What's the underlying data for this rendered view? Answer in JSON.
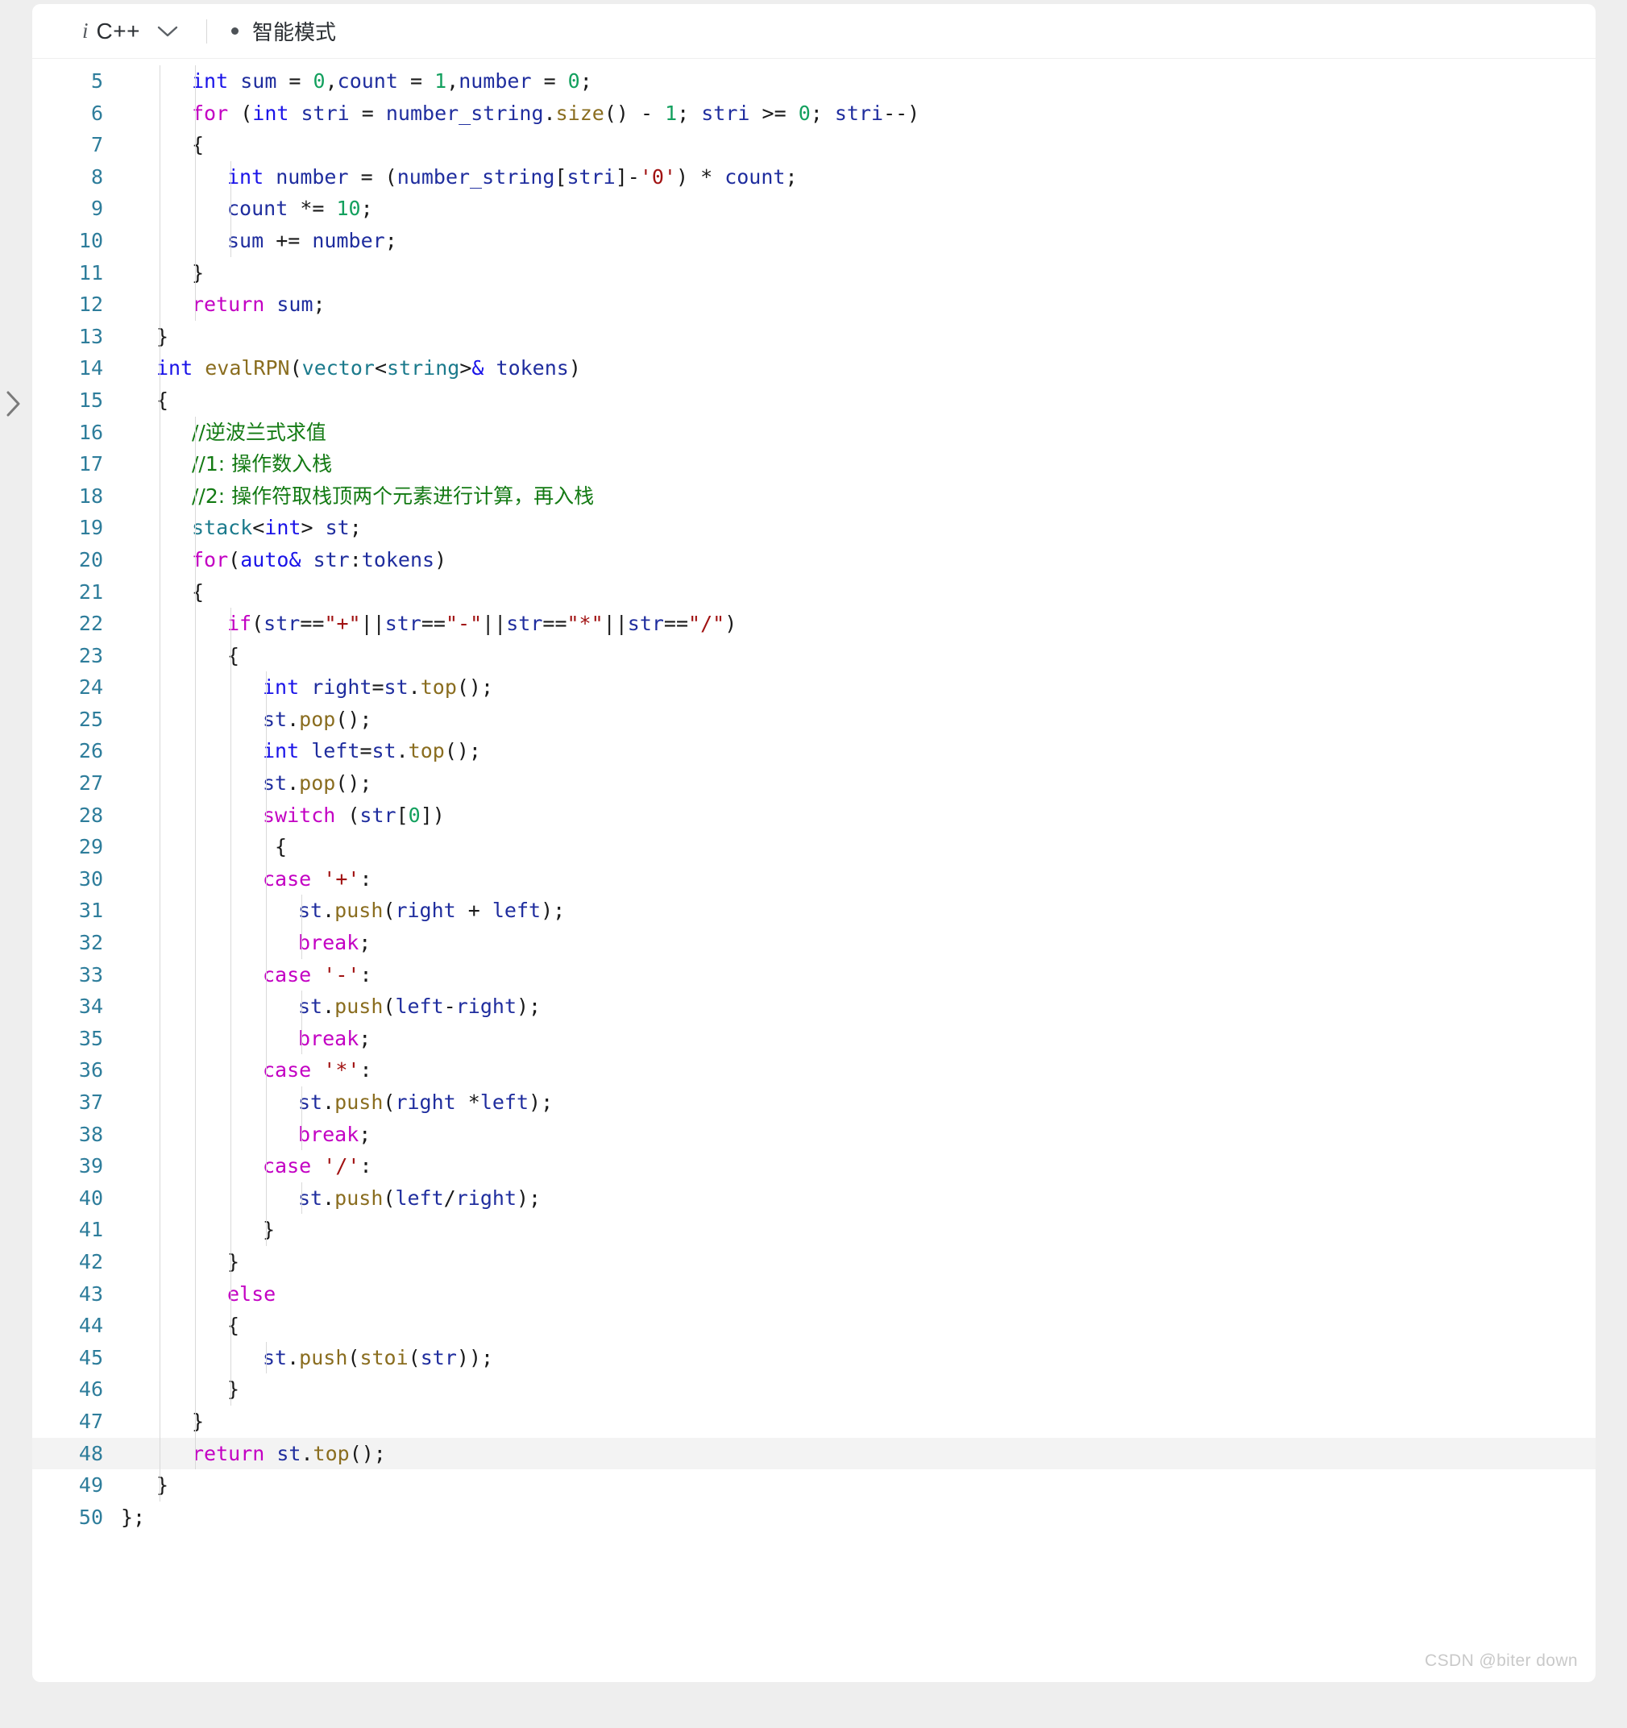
{
  "toolbar": {
    "info_icon": "i",
    "language": "C++",
    "chevron_icon": "chevron-down-icon",
    "status_dot": "status-dot",
    "mode_label": "智能模式"
  },
  "left_rail": {
    "collapse_icon": "chevron-right-icon"
  },
  "watermark": "CSDN @biter down",
  "editor": {
    "first_visible_line": 5,
    "last_visible_line": 50,
    "highlighted_line": 48,
    "colors": {
      "background": "#ffffff",
      "page_background": "#eeeeee",
      "line_number": "#2e7d9b",
      "keyword": "#c300c3",
      "type": "#1a13e8",
      "number": "#13a05e",
      "string": "#a11212",
      "function": "#8a6d1f",
      "class_name": "#1b7a8c",
      "identifier": "#1f2d9e",
      "comment": "#137a13",
      "plain": "#1a1a1a",
      "highlight_band": "#f3f3f3",
      "indent_guide": "#d9d9d9"
    },
    "lines": [
      {
        "num": 5,
        "indent": 2,
        "guides": 2,
        "text": "int sum = 0,count = 1,number = 0;"
      },
      {
        "num": 6,
        "indent": 2,
        "guides": 2,
        "text": "for (int stri = number_string.size() - 1; stri >= 0; stri--)"
      },
      {
        "num": 7,
        "indent": 2,
        "guides": 2,
        "text": "{"
      },
      {
        "num": 8,
        "indent": 3,
        "guides": 3,
        "text": "int number = (number_string[stri]-'0') * count;"
      },
      {
        "num": 9,
        "indent": 3,
        "guides": 3,
        "text": "count *= 10;"
      },
      {
        "num": 10,
        "indent": 3,
        "guides": 3,
        "text": "sum += number;"
      },
      {
        "num": 11,
        "indent": 2,
        "guides": 2,
        "text": "}"
      },
      {
        "num": 12,
        "indent": 2,
        "guides": 2,
        "text": "return sum;"
      },
      {
        "num": 13,
        "indent": 1,
        "guides": 1,
        "text": "}"
      },
      {
        "num": 14,
        "indent": 1,
        "guides": 1,
        "text": "int evalRPN(vector<string>& tokens)"
      },
      {
        "num": 15,
        "indent": 1,
        "guides": 1,
        "text": "{"
      },
      {
        "num": 16,
        "indent": 2,
        "guides": 2,
        "text": "//逆波兰式求值"
      },
      {
        "num": 17,
        "indent": 2,
        "guides": 2,
        "text": "//1: 操作数入栈"
      },
      {
        "num": 18,
        "indent": 2,
        "guides": 2,
        "text": "//2: 操作符取栈顶两个元素进行计算，再入栈"
      },
      {
        "num": 19,
        "indent": 2,
        "guides": 2,
        "text": "stack<int> st;"
      },
      {
        "num": 20,
        "indent": 2,
        "guides": 2,
        "text": "for(auto& str:tokens)"
      },
      {
        "num": 21,
        "indent": 2,
        "guides": 2,
        "text": "{"
      },
      {
        "num": 22,
        "indent": 3,
        "guides": 3,
        "text": "if(str==\"+\"||str==\"-\"||str==\"*\"||str==\"/\")"
      },
      {
        "num": 23,
        "indent": 3,
        "guides": 3,
        "text": "{"
      },
      {
        "num": 24,
        "indent": 4,
        "guides": 4,
        "text": "int right=st.top();"
      },
      {
        "num": 25,
        "indent": 4,
        "guides": 4,
        "text": "st.pop();"
      },
      {
        "num": 26,
        "indent": 4,
        "guides": 4,
        "text": "int left=st.top();"
      },
      {
        "num": 27,
        "indent": 4,
        "guides": 4,
        "text": "st.pop();"
      },
      {
        "num": 28,
        "indent": 4,
        "guides": 4,
        "text": "switch (str[0])"
      },
      {
        "num": 29,
        "indent": 4,
        "guides": 4,
        "text": " {"
      },
      {
        "num": 30,
        "indent": 4,
        "guides": 4,
        "text": "case '+':"
      },
      {
        "num": 31,
        "indent": 5,
        "guides": 5,
        "text": "st.push(right + left);"
      },
      {
        "num": 32,
        "indent": 5,
        "guides": 5,
        "text": "break;"
      },
      {
        "num": 33,
        "indent": 4,
        "guides": 4,
        "text": "case '-':"
      },
      {
        "num": 34,
        "indent": 5,
        "guides": 5,
        "text": "st.push(left-right);"
      },
      {
        "num": 35,
        "indent": 5,
        "guides": 5,
        "text": "break;"
      },
      {
        "num": 36,
        "indent": 4,
        "guides": 4,
        "text": "case '*':"
      },
      {
        "num": 37,
        "indent": 5,
        "guides": 5,
        "text": "st.push(right *left);"
      },
      {
        "num": 38,
        "indent": 5,
        "guides": 5,
        "text": "break;"
      },
      {
        "num": 39,
        "indent": 4,
        "guides": 4,
        "text": "case '/':"
      },
      {
        "num": 40,
        "indent": 5,
        "guides": 5,
        "text": "st.push(left/right);"
      },
      {
        "num": 41,
        "indent": 4,
        "guides": 4,
        "text": "}"
      },
      {
        "num": 42,
        "indent": 3,
        "guides": 3,
        "text": "}"
      },
      {
        "num": 43,
        "indent": 3,
        "guides": 3,
        "text": "else"
      },
      {
        "num": 44,
        "indent": 3,
        "guides": 3,
        "text": "{"
      },
      {
        "num": 45,
        "indent": 4,
        "guides": 4,
        "text": "st.push(stoi(str));"
      },
      {
        "num": 46,
        "indent": 3,
        "guides": 3,
        "text": "}"
      },
      {
        "num": 47,
        "indent": 2,
        "guides": 2,
        "text": "}"
      },
      {
        "num": 48,
        "indent": 2,
        "guides": 2,
        "text": "return st.top();"
      },
      {
        "num": 49,
        "indent": 1,
        "guides": 1,
        "text": "}"
      },
      {
        "num": 50,
        "indent": 0,
        "guides": 0,
        "text": "};"
      }
    ]
  }
}
